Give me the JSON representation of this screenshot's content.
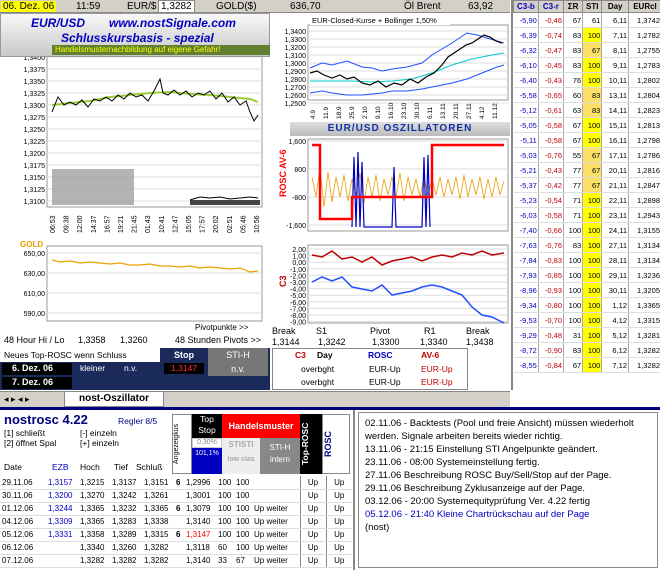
{
  "topbar": {
    "date": "06. Dez. 06",
    "time": "11:59",
    "pair": "EUR/$",
    "rate": "1,3282",
    "gold_label": "GOLD($)",
    "gold": "636,70",
    "oil_label": "Öl Brent",
    "oil": "63,92"
  },
  "header": {
    "pair": "EUR/USD",
    "site": "www.nostSignale.com",
    "subtitle": "Schlusskursbasis - spezial",
    "warning": "Handelsmusternachbildung auf eigene Gefahr!"
  },
  "main_chart": {
    "y_ticks": [
      "1,3400",
      "1,3375",
      "1,3350",
      "1,3325",
      "1,3300",
      "1,3275",
      "1,3250",
      "1,3225",
      "1,3200",
      "1,3175",
      "1,3150",
      "1,3125",
      "1,3100"
    ],
    "x_ticks": [
      "06:53",
      "09:38",
      "12:00",
      "14:37",
      "16:57",
      "19:21",
      "21:45",
      "01:43",
      "10:41",
      "12:47",
      "15:05",
      "17:57",
      "20:02",
      "02:51",
      "05:46",
      "10:56"
    ]
  },
  "bollinger": {
    "title": "EUR-Closed-Kurse + Bollinger 1,50%",
    "y_ticks": [
      "1,3400",
      "1,3300",
      "1,3200",
      "1,3100",
      "1,3000",
      "1,2900",
      "1,2800",
      "1,2700",
      "1,2600",
      "1,2500"
    ],
    "x_ticks": [
      "4.9",
      "18.9",
      "2.10",
      "16.10",
      "30.10",
      "13.11",
      "27.11",
      "11.12"
    ],
    "x_ticks2": [
      "11.9",
      "25.9",
      "9.10",
      "23.10",
      "6.11",
      "20.11",
      "4.12"
    ]
  },
  "osc_title": "EUR/USD  OSZILLATOREN",
  "rosc": {
    "label": "ROSC AV-6",
    "y_ticks": [
      "1,600",
      "800",
      "-800",
      "-1,600"
    ]
  },
  "c3": {
    "label": "C3",
    "y_ticks": [
      "2,00",
      "1,00",
      "0,00",
      "-1,00",
      "-2,00",
      "-3,00",
      "-4,00",
      "-5,00",
      "-6,00",
      "-7,00",
      "-8,00",
      "-9,00"
    ]
  },
  "gold_chart": {
    "label": "GOLD",
    "y_ticks": [
      "650,00",
      "630,00",
      "610,00",
      "590,00"
    ],
    "footer": "Pivotpunkte >>"
  },
  "pivots": {
    "hi_lo_label": "48 Hour Hi / Lo",
    "hi": "1,3358",
    "lo": "1,3260",
    "pivot_label": "48 Stunden Pivots >>",
    "cols": [
      "Break",
      "S1",
      "Pivot",
      "R1",
      "Break"
    ],
    "vals": [
      "1,3144",
      "1,3242",
      "1,3300",
      "1,3340",
      "1,3438"
    ]
  },
  "signal_panel": {
    "title": "Neues Top-ROSC wenn Schluss",
    "stop_hdr": "Stop",
    "stih_hdr": "STI-H",
    "rows": [
      {
        "date": "6. Dez. 06",
        "word": "kleiner",
        "val": "n.v.",
        "stop": "1,3147",
        "stih": "n.v."
      },
      {
        "date": "7. Dez. 06",
        "word": "",
        "val": "",
        "stop": "",
        "stih": ""
      }
    ],
    "c3_hdr": "C3",
    "day_hdr": "Day",
    "rosc_hdr": "ROSC",
    "av6_hdr": "AV-6",
    "c3_rows": [
      "overbght",
      "overbght"
    ],
    "rosc_rows": [
      "EUR-Up",
      "EUR-Up"
    ],
    "av6_rows": [
      "EUR-Up",
      "EUR-Up"
    ]
  },
  "tab": {
    "label": "nost-Oszillator"
  },
  "right_table": {
    "headers": [
      "C3-b",
      "C3-r",
      "ΣR",
      "STI",
      "Day",
      "EURcl"
    ],
    "rows": [
      [
        "-5,90",
        "-0,46",
        "67",
        "61",
        "6,11",
        "1,3742"
      ],
      [
        "-6,39",
        "-0,74",
        "83",
        "100",
        "7,11",
        "1,2782"
      ],
      [
        "-6,32",
        "-0,47",
        "83",
        "67",
        "8,11",
        "1,2755"
      ],
      [
        "-6,10",
        "-0,45",
        "83",
        "100",
        "9,11",
        "1,2783"
      ],
      [
        "-6,40",
        "-0,43",
        "76",
        "100",
        "10,11",
        "1,2802"
      ],
      [
        "-5,58",
        "-0,65",
        "60",
        "83",
        "13,11",
        "1,2804"
      ],
      [
        "-5,12",
        "-0,61",
        "63",
        "83",
        "14,11",
        "1,2823"
      ],
      [
        "-5,05",
        "-0,58",
        "67",
        "100",
        "15,11",
        "1,2813"
      ],
      [
        "-5,11",
        "-0,58",
        "67",
        "100",
        "16,11",
        "1,2798"
      ],
      [
        "-5,03",
        "-0,76",
        "55",
        "67",
        "17,11",
        "1,2786"
      ],
      [
        "-5,21",
        "-0,43",
        "77",
        "67",
        "20,11",
        "1,2816"
      ],
      [
        "-5,37",
        "-0,42",
        "77",
        "67",
        "21,11",
        "1,2847"
      ],
      [
        "-5,23",
        "-0,54",
        "71",
        "100",
        "22,11",
        "1,2898"
      ],
      [
        "-6,03",
        "-0,58",
        "71",
        "100",
        "23,11",
        "1,2943"
      ],
      [
        "-7,40",
        "-0,66",
        "100",
        "100",
        "24,11",
        "1,3155"
      ],
      [
        "-7,63",
        "-0,76",
        "83",
        "100",
        "27,11",
        "1,3134"
      ],
      [
        "-7,84",
        "-0,83",
        "100",
        "100",
        "28,11",
        "1,3134"
      ],
      [
        "-7,93",
        "-0,85",
        "100",
        "100",
        "29,11",
        "1,3236"
      ],
      [
        "-8,96",
        "-0,93",
        "100",
        "100",
        "30,11",
        "1,3205"
      ],
      [
        "-9,34",
        "-0,80",
        "100",
        "100",
        "1,12",
        "1,3365"
      ],
      [
        "-9,53",
        "-0,70",
        "100",
        "100",
        "4,12",
        "1,3315"
      ],
      [
        "-9,29",
        "-0,48",
        "31",
        "100",
        "5,12",
        "1,3281"
      ],
      [
        "-8,72",
        "-0,90",
        "83",
        "100",
        "6,12",
        "1,3282"
      ],
      [
        "-8,55",
        "-0,84",
        "67",
        "100",
        "7,12",
        "1,3282"
      ]
    ]
  },
  "nostrosc": {
    "title": "nostrosc 4.22",
    "regler": "Regler 8/5",
    "opt1": "[1] schließt",
    "opt2": "[2] öffnet Spal",
    "opt3": "[-] einzeln",
    "opt4": "[+] einzeln",
    "cols": [
      "Date",
      "EZB",
      "Hoch",
      "Tief",
      "Schluß"
    ],
    "angezeige": "Angezeigkus",
    "topstop_hdr": "Top Stop",
    "handel_hdr": "Handelsmuster",
    "pct1": "0,30%",
    "pct2": "101,1%",
    "stisti": "STISTI",
    "low_clas": "low clas",
    "stih": "STI-H intern",
    "top_rosc": "Top-ROSC",
    "rosc": "ROSC",
    "rows": [
      [
        "29.11.06",
        "1,3157",
        "1,3215",
        "1,3137",
        "1,3151",
        "6",
        "1,2996",
        "100",
        "100",
        "",
        "Up",
        "Up"
      ],
      [
        "30.11.06",
        "1,3200",
        "1,3270",
        "1,3242",
        "1,3261",
        "",
        "1,3001",
        "100",
        "100",
        "",
        "Up",
        "Up"
      ],
      [
        "01.12.06",
        "1,3244",
        "1,3365",
        "1,3232",
        "1,3365",
        "6",
        "1,3079",
        "100",
        "100",
        "Up weiter",
        "Up",
        "Up"
      ],
      [
        "04.12.06",
        "1,3309",
        "1,3365",
        "1,3283",
        "1,3338",
        "",
        "1,3140",
        "100",
        "100",
        "Up weiter",
        "Up",
        "Up"
      ],
      [
        "05.12.06",
        "1,3331",
        "1,3358",
        "1,3289",
        "1,3315",
        "6",
        "1,3147",
        "100",
        "100",
        "Up weiter",
        "Up",
        "Up"
      ],
      [
        "06.12.06",
        "",
        "1,3340",
        "1,3260",
        "1,3282",
        "",
        "1,3118",
        "60",
        "100",
        "Up weiter",
        "Up",
        "Up"
      ],
      [
        "07.12.06",
        "",
        "1,3282",
        "1,3282",
        "1,3282",
        "",
        "1,3140",
        "33",
        "67",
        "Up weiter",
        "Up",
        "Up"
      ]
    ]
  },
  "notes": [
    {
      "text": "02.11.06 - Backtests (Pool und freie Ansicht) müssen wiederholt werden. Signale arbeiten bereits wieder richtig.",
      "color": "#000"
    },
    {
      "text": "13.11.06 - 21:15 Einstellung STI Angelpunkte geändert.",
      "color": "#000"
    },
    {
      "text": "23.11.06 - 08:00 Systemeinstellung fertig.",
      "color": "#000"
    },
    {
      "text": "27.11.06 Beschreibung ROSC Buy/Sell/Stop auf der Page.",
      "color": "#000"
    },
    {
      "text": "29.11.06 Beschreibung Zyklusanzeige auf der Page.",
      "color": "#000"
    },
    {
      "text": "03.12.06 - 20:00 Systemequityprüfung Ver. 4.22 fertig",
      "color": "#000"
    },
    {
      "text": "05.12.06 - 21:40 Kleine Chartrückschau auf der Page",
      "color": "#0000c0"
    },
    {
      "text": "(nost)",
      "color": "#000"
    }
  ],
  "colors": {
    "accent": "#0000c0",
    "signal_red": "#ff0000",
    "bar_yellow": "#ffff00"
  }
}
